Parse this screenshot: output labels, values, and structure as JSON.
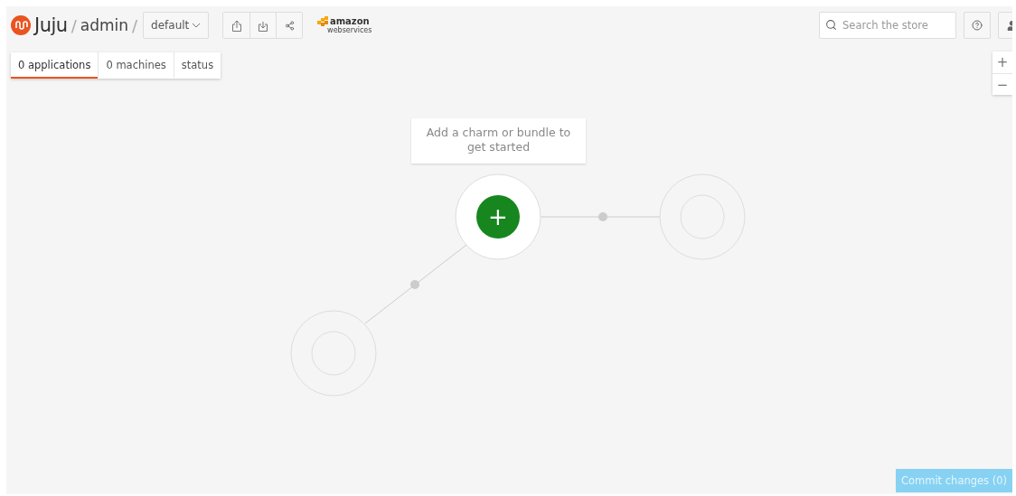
{
  "header": {
    "breadcrumb": [
      {
        "kind": "logo",
        "label": "Juju"
      },
      {
        "kind": "separator",
        "label": "/"
      },
      {
        "kind": "user",
        "label": "admin"
      },
      {
        "kind": "separator",
        "label": "/"
      }
    ],
    "model": {
      "label": "default"
    },
    "cloud": {
      "name": "amazon",
      "sub": "webservices"
    },
    "search": {
      "placeholder": "Search the store"
    }
  },
  "tabs": [
    {
      "label": "0 applications",
      "selected": true
    },
    {
      "label": "0 machines",
      "selected": false
    },
    {
      "label": "status",
      "selected": false
    }
  ],
  "zoom": [
    "+",
    "−"
  ],
  "canvas": {
    "hint": "Add a charm or bundle to get started",
    "add": "+"
  },
  "commit": {
    "label": "Commit changes (0)",
    "disabled": true
  }
}
